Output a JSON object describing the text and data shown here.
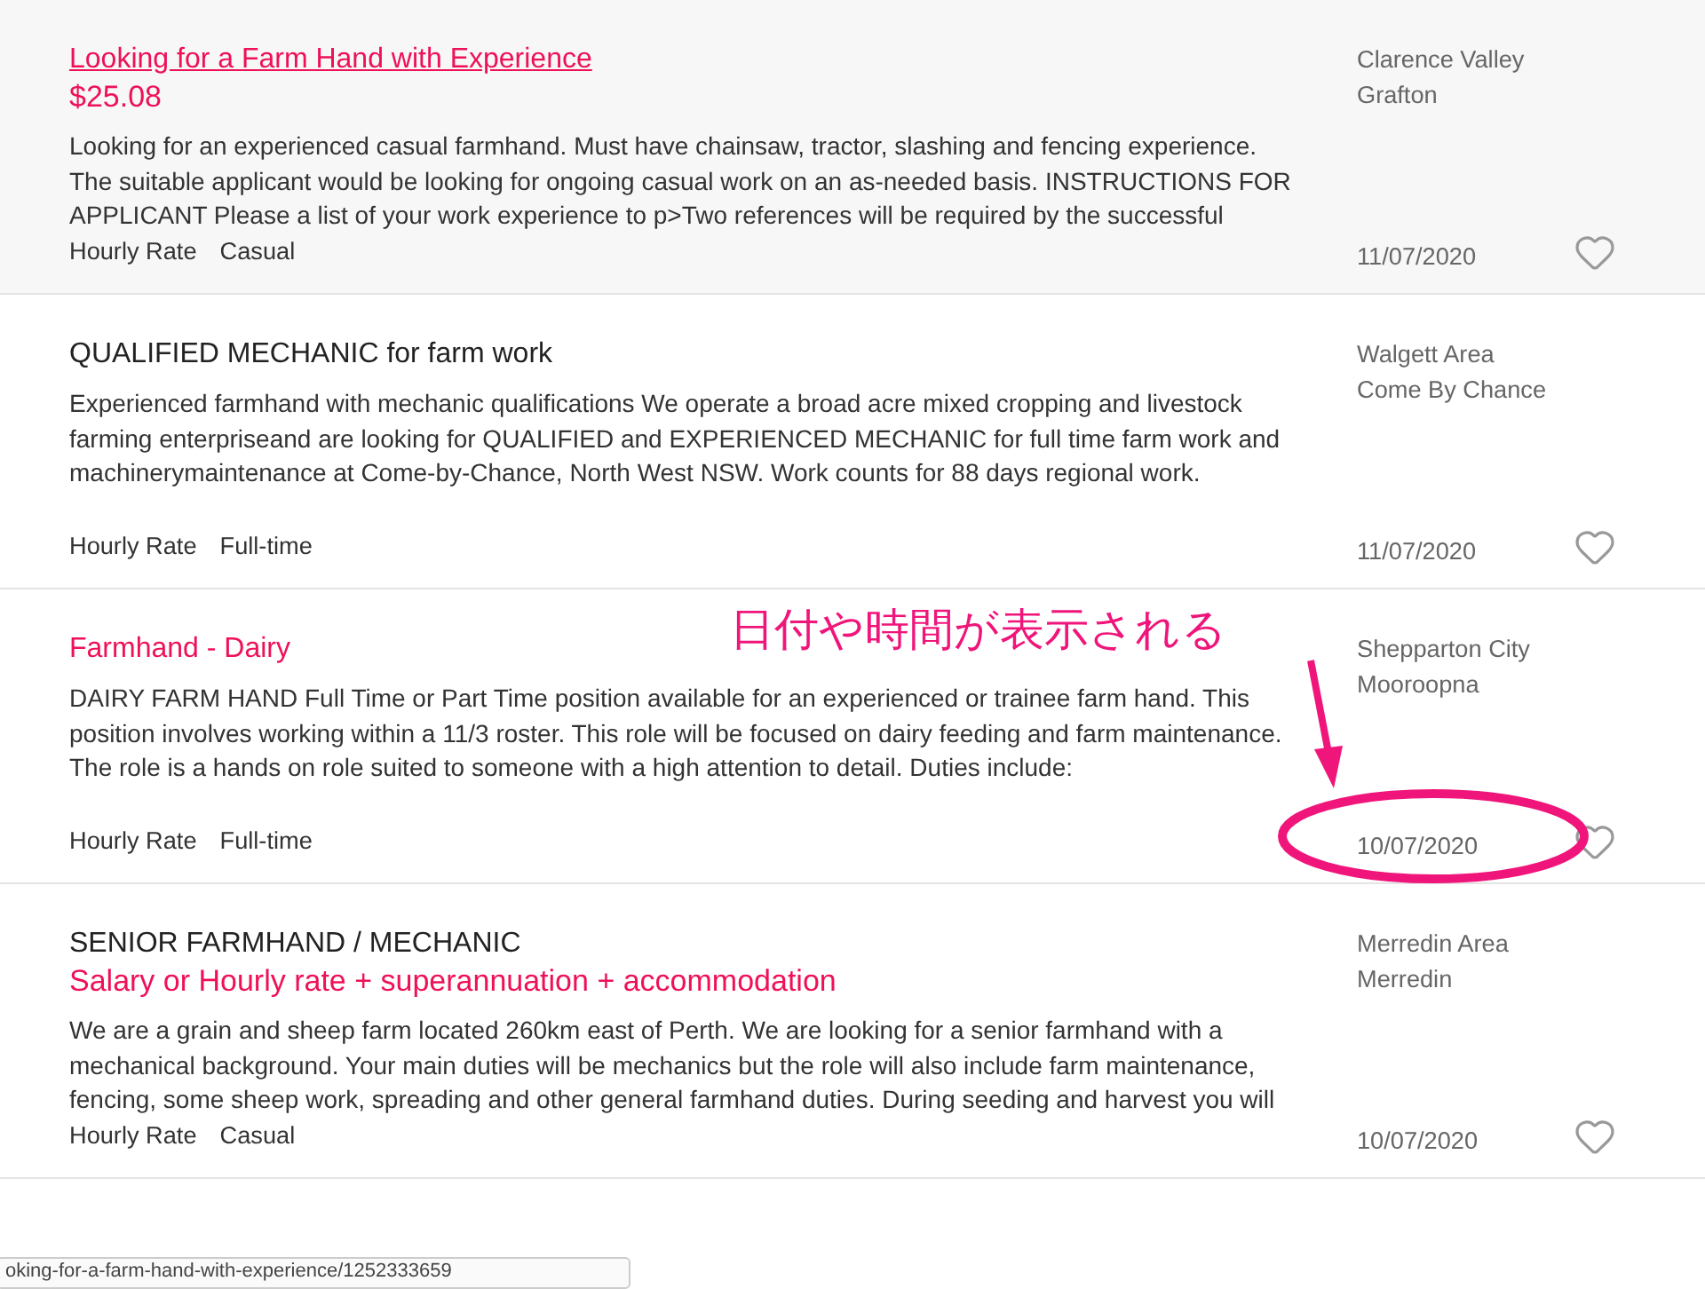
{
  "jobs": [
    {
      "title": "Looking for a Farm Hand with Experience",
      "featured": true,
      "hovered": true,
      "salary": "$25.08",
      "description": "Looking for an experienced casual farmhand. Must have chainsaw, tractor, slashing and fencing experience. The suitable applicant would be looking for ongoing casual work on an as-needed basis. INSTRUCTIONS FOR APPLICANT Please a list of your work experience to p>Two references will be required by the successful",
      "tags": [
        "Hourly Rate",
        "Casual"
      ],
      "location": [
        "Clarence Valley",
        "Grafton"
      ],
      "date": "11/07/2020"
    },
    {
      "title": "QUALIFIED MECHANIC for farm work",
      "featured": false,
      "hovered": false,
      "description": "Experienced farmhand with mechanic qualifications We operate a broad acre mixed cropping and livestock farming enterpriseand are looking for QUALIFIED and EXPERIENCED MECHANIC for full time farm work and machinerymaintenance at Come-by-Chance, North West NSW. Work counts for 88 days regional work.",
      "tags": [
        "Hourly Rate",
        "Full-time"
      ],
      "location": [
        "Walgett Area",
        "Come By Chance"
      ],
      "date": "11/07/2020"
    },
    {
      "title": "Farmhand - Dairy",
      "featured": true,
      "hovered": false,
      "description": "DAIRY FARM HAND Full Time or Part Time position available for an experienced or trainee farm hand. This position involves working within a 11/3 roster. This role will be focused on dairy feeding and farm maintenance. The role is a hands on role suited to someone with a high attention to detail. Duties include:",
      "tags": [
        "Hourly Rate",
        "Full-time"
      ],
      "location": [
        "Shepparton City",
        "Mooroopna"
      ],
      "date": "10/07/2020",
      "annotation": "日付や時間が表示される"
    },
    {
      "title": "SENIOR FARMHAND / MECHANIC",
      "featured": false,
      "hovered": false,
      "salary": "Salary or Hourly rate + superannuation + accommodation",
      "description": "We are a grain and sheep farm located 260km east of Perth. We are looking for a senior farmhand with a mechanical background. Your main duties will be mechanics but the role will also include farm maintenance, fencing, some sheep work, spreading and other general farmhand duties. During seeding and harvest you will",
      "tags": [
        "Hourly Rate",
        "Casual"
      ],
      "location": [
        "Merredin Area",
        "Merredin"
      ],
      "date": "10/07/2020"
    }
  ],
  "status_url": "oking-for-a-farm-hand-with-experience/1252333659"
}
